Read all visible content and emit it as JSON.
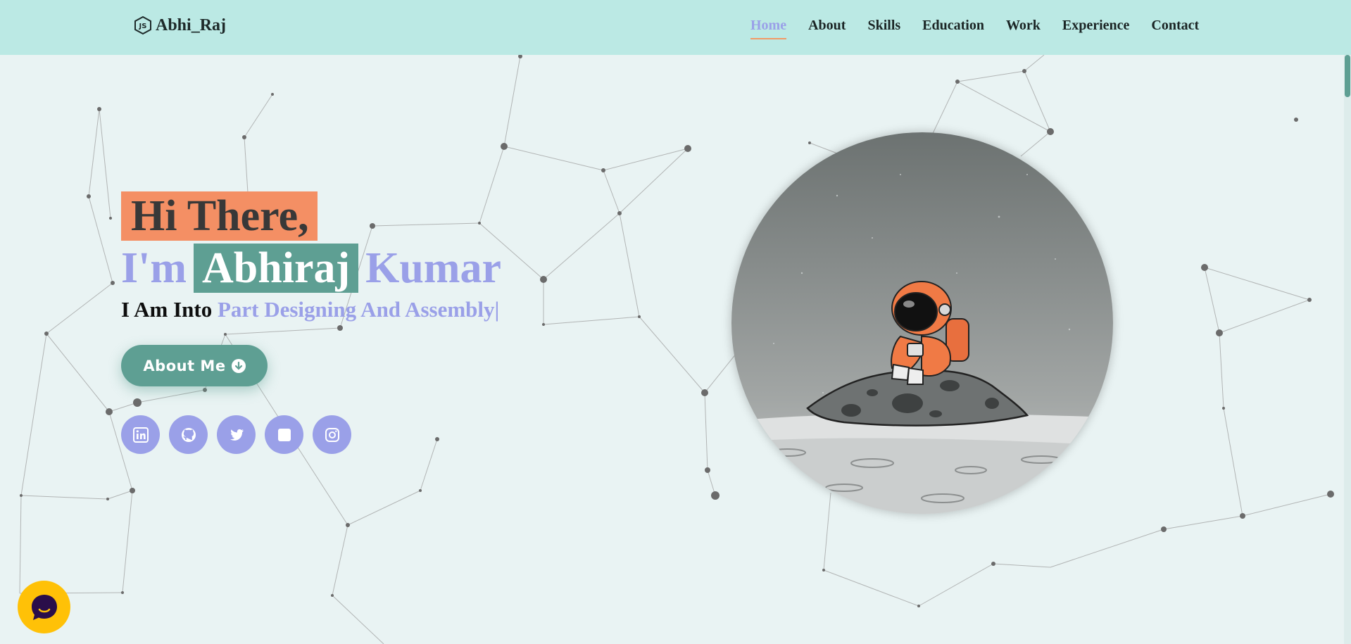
{
  "header": {
    "logo_text": "Abhi_Raj",
    "logo_icon": "nodejs-icon",
    "nav": [
      {
        "label": "Home",
        "active": true
      },
      {
        "label": "About"
      },
      {
        "label": "Skills"
      },
      {
        "label": "Education"
      },
      {
        "label": "Work"
      },
      {
        "label": "Experience"
      },
      {
        "label": "Contact"
      }
    ]
  },
  "hero": {
    "greeting": "Hi There,",
    "im_prefix": "I'm",
    "first_name": "Abhiraj",
    "last_name": "Kumar",
    "tagline_prefix": "I Am Into",
    "tagline_typed": "Part Designing And Assembly|",
    "about_button": "About Me",
    "about_icon": "arrow-circle-down-icon",
    "socials": [
      {
        "name": "linkedin-icon"
      },
      {
        "name": "github-icon"
      },
      {
        "name": "twitter-icon"
      },
      {
        "name": "square-icon"
      },
      {
        "name": "instagram-icon"
      }
    ],
    "image": "astronaut-on-moon-illustration"
  },
  "widgets": {
    "chat": "chat-bubble-icon"
  },
  "colors": {
    "header_bg": "#bbe9e4",
    "page_bg": "#e9f3f3",
    "accent_purple": "#9aa0e8",
    "accent_orange": "#f48f64",
    "accent_teal": "#5e9f93",
    "chat_yellow": "#ffc107"
  }
}
